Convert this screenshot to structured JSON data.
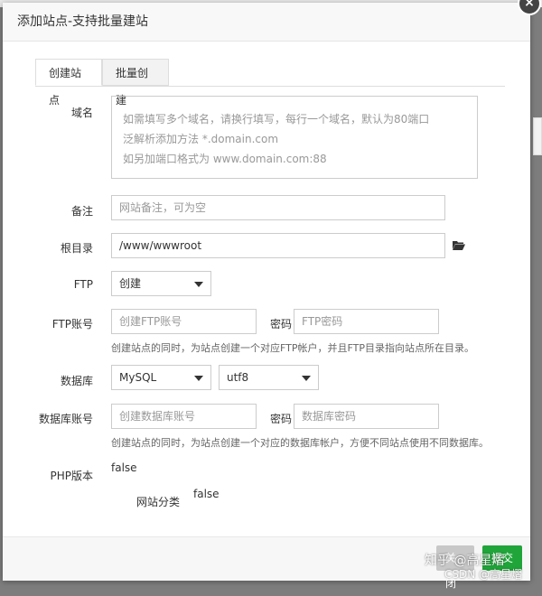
{
  "dialog": {
    "title": "添加站点-支持批量建站",
    "close_symbol": "×"
  },
  "tabs": [
    {
      "label": "创建站点",
      "active": true
    },
    {
      "label": "批量创建",
      "active": false
    }
  ],
  "form": {
    "domain": {
      "label": "域名",
      "placeholder_lines": [
        "如需填写多个域名，请换行填写，每行一个域名，默认为80端口",
        "泛解析添加方法 *.domain.com",
        "如另加端口格式为 www.domain.com:88"
      ]
    },
    "remark": {
      "label": "备注",
      "placeholder": "网站备注，可为空"
    },
    "root": {
      "label": "根目录",
      "value": "/www/wwwroot",
      "icon": "folder-open-icon"
    },
    "ftp": {
      "label": "FTP",
      "selected": "创建"
    },
    "ftp_account": {
      "label": "FTP账号",
      "user_placeholder": "创建FTP账号",
      "password_label": "密码",
      "password_placeholder": "FTP密码",
      "help": "创建站点的同时，为站点创建一个对应FTP帐户，并且FTP目录指向站点所在目录。"
    },
    "database": {
      "label": "数据库",
      "type_selected": "MySQL",
      "charset_selected": "utf8"
    },
    "db_account": {
      "label": "数据库账号",
      "user_placeholder": "创建数据库账号",
      "password_label": "密码",
      "password_placeholder": "数据库密码",
      "help": "创建站点的同时，为站点创建一个对应的数据库帐户，方便不同站点使用不同数据库。"
    },
    "php": {
      "label": "PHP版本",
      "value": "false"
    },
    "category": {
      "label": "网站分类",
      "value": "false"
    }
  },
  "footer": {
    "cancel_label": "关闭",
    "submit_label": "提交"
  },
  "watermark": {
    "line1": "知乎 @高星熠",
    "line2": "CSDN @高星熠"
  },
  "colors": {
    "submit": "#20a53a",
    "cancel": "#c8c8c8"
  }
}
